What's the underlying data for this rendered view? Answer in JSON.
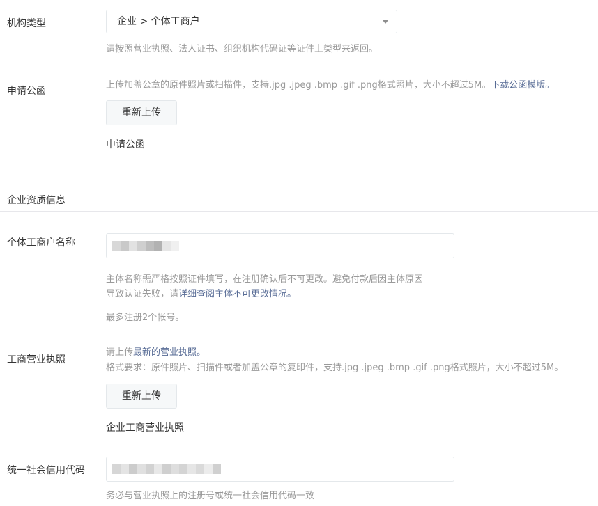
{
  "org_type": {
    "label": "机构类型",
    "selected": "企业 > 个体工商户",
    "hint": "请按照营业执照、法人证书、组织机构代码证等证件上类型来返回。"
  },
  "application_letter": {
    "label": "申请公函",
    "hint_prefix": "上传加盖公章的原件照片或扫描件，支持.jpg .jpeg .bmp .gif .png格式照片，大小不超过5M。",
    "hint_link": "下载公函模版。",
    "reupload_label": "重新上传",
    "filename": "申请公函"
  },
  "qualification_section": {
    "title": "企业资质信息"
  },
  "business_name": {
    "label": "个体工商户名称",
    "hint_line1": "主体名称需严格按照证件填写，在注册确认后不可更改。避免付款后因主体原因",
    "hint_line2_prefix": "导致认证失败，请",
    "hint_line2_link": "详细查阅主体不可更改情况。",
    "limit_note": "最多注册2个帐号。"
  },
  "business_license": {
    "label": "工商营业执照",
    "hint_prefix": "请上传",
    "hint_link": "最新的营业执照。",
    "format_requirement": "格式要求：原件照片、扫描件或者加盖公章的复印件，支持.jpg .jpeg .bmp .gif .png格式照片，大小不超过5M。",
    "reupload_label": "重新上传",
    "filename": "企业工商营业执照"
  },
  "credit_code": {
    "label": "统一社会信用代码",
    "hint": "务必与营业执照上的注册号或统一社会信用代码一致"
  }
}
